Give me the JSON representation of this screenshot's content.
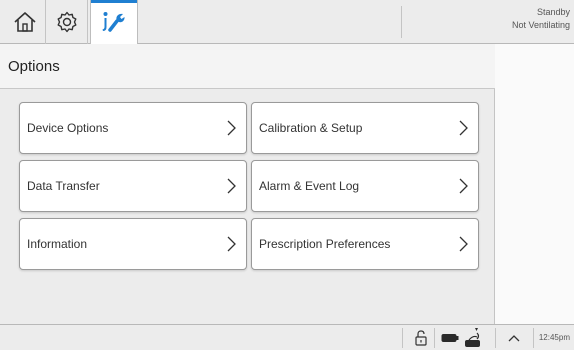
{
  "status": {
    "line1": "Standby",
    "line2": "Not Ventilating"
  },
  "tabs": [
    {
      "icon": "home-icon",
      "active": false
    },
    {
      "icon": "gear-icon",
      "active": false
    },
    {
      "icon": "tools-icon",
      "active": true
    }
  ],
  "page": {
    "title": "Options"
  },
  "options": [
    {
      "label": "Device Options"
    },
    {
      "label": "Calibration & Setup"
    },
    {
      "label": "Data Transfer"
    },
    {
      "label": "Alarm & Event Log"
    },
    {
      "label": "Information"
    },
    {
      "label": "Prescription Preferences"
    }
  ],
  "bottombar": {
    "icons": [
      "unlock-icon",
      "battery-icon",
      "ac-power-icon",
      "chevron-up-icon"
    ],
    "time": "12:45pm"
  },
  "colors": {
    "accent": "#1f7fd1",
    "background": "#ececec"
  }
}
